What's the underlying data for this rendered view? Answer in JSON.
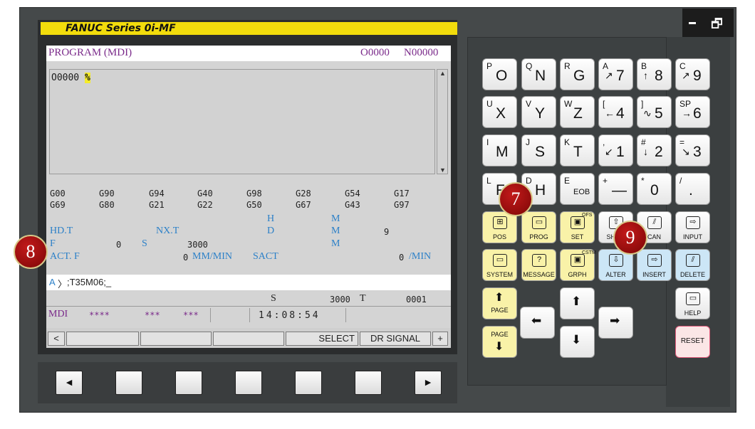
{
  "window_controls": {
    "minimize": "–",
    "restore": "🗗"
  },
  "brand": {
    "title": "FANUC Series 0i-MF"
  },
  "screen": {
    "mode_title": "PROGRAM (MDI)",
    "program_no": "O0000",
    "seq_no": "N00000",
    "editor_line_prefix": "O0000",
    "editor_cursor": "%",
    "gcodes_row1": [
      "G00",
      "G90",
      "G94",
      "G40",
      "G98",
      "G28",
      "G54",
      "G17"
    ],
    "gcodes_row2": [
      "G69",
      "G80",
      "G21",
      "G22",
      "G50",
      "G67",
      "G43",
      "G97"
    ],
    "col_h": "H",
    "col_m1": "M",
    "col_m2": "M",
    "col_m3": "M",
    "col_d": "D",
    "hd_t": "HD.T",
    "nx_t": "NX.T",
    "m_value": "9",
    "f_label": "F",
    "f_value": "0",
    "s_label": "S",
    "s_value": "3000",
    "act_f": "ACT. F",
    "act_f_value": "0",
    "act_f_unit": "MM/MIN",
    "sact": "SACT",
    "sact_value": "0",
    "sact_unit": "/MIN",
    "input_prefix": "A",
    "input_arrow": "〉",
    "input_text": ";T35M06;_",
    "status_s": "S",
    "status_s_value": "3000",
    "status_t": "T",
    "status_t_value": "0001",
    "mode": "MDI",
    "stars1": "****",
    "stars2": "***",
    "stars3": "***",
    "clock": "14:08:54",
    "softkey_left": "<",
    "softkey_select": "SELECT",
    "softkey_dr": "DR SIGNAL OFF",
    "softkey_right": "+"
  },
  "hw_buttons": [
    "◄",
    "",
    "",
    "",
    "",
    "",
    "►"
  ],
  "keys": {
    "O": {
      "sub": "P",
      "main": "O"
    },
    "N": {
      "sub": "Q",
      "main": "N"
    },
    "G": {
      "sub": "R",
      "main": "G"
    },
    "k7": {
      "sub": "A",
      "main": "7",
      "arrow": "↗"
    },
    "k8": {
      "sub": "B",
      "main": "8",
      "arrow": "↑"
    },
    "k9": {
      "sub": "C",
      "main": "9",
      "arrow": "↗"
    },
    "X": {
      "sub": "U",
      "main": "X"
    },
    "Y": {
      "sub": "V",
      "main": "Y"
    },
    "Z": {
      "sub": "W",
      "main": "Z"
    },
    "k4": {
      "sub": "[",
      "main": "4",
      "arrow": "←"
    },
    "k5": {
      "sub": "]",
      "main": "5",
      "arrow": "∿"
    },
    "k6": {
      "sub": "SP",
      "main": "6",
      "arrow": "→"
    },
    "M": {
      "sub": "I",
      "main": "M"
    },
    "S": {
      "sub": "J",
      "main": "S"
    },
    "T": {
      "sub": "K",
      "main": "T"
    },
    "k1": {
      "sub": ",",
      "main": "1",
      "arrow": "↙"
    },
    "k2": {
      "sub": "#",
      "main": "2",
      "arrow": "↓"
    },
    "k3": {
      "sub": "=",
      "main": "3",
      "arrow": "↘"
    },
    "F": {
      "sub": "L",
      "main": "F"
    },
    "H": {
      "sub": "D",
      "main": "H"
    },
    "EOB": {
      "sub": "E",
      "main": "EOB"
    },
    "minus": {
      "sub": "+",
      "main": "—"
    },
    "k0": {
      "sub": "*",
      "main": "0"
    },
    "dot": {
      "sub": "/",
      "main": "."
    },
    "POS": "POS",
    "PROG": "PROG",
    "OFS": {
      "top": "OFS",
      "bottom": "SET"
    },
    "SHIFT": "SHIFT",
    "CAN": "CAN",
    "INPUT": "INPUT",
    "SYSTEM": "SYSTEM",
    "MESSAGE": "MESSAGE",
    "CSTM": {
      "top": "CSTM",
      "bottom": "GRPH"
    },
    "ALTER": "ALTER",
    "INSERT": "INSERT",
    "DELETE": "DELETE",
    "PAGE_UP": "PAGE",
    "PAGE_DOWN": "PAGE",
    "HELP": "HELP",
    "RESET": "RESET",
    "up": "⬆",
    "down": "⬇",
    "left": "⬅",
    "right": "➡"
  },
  "badges": {
    "b7": "7",
    "b8": "8",
    "b9": "9"
  }
}
